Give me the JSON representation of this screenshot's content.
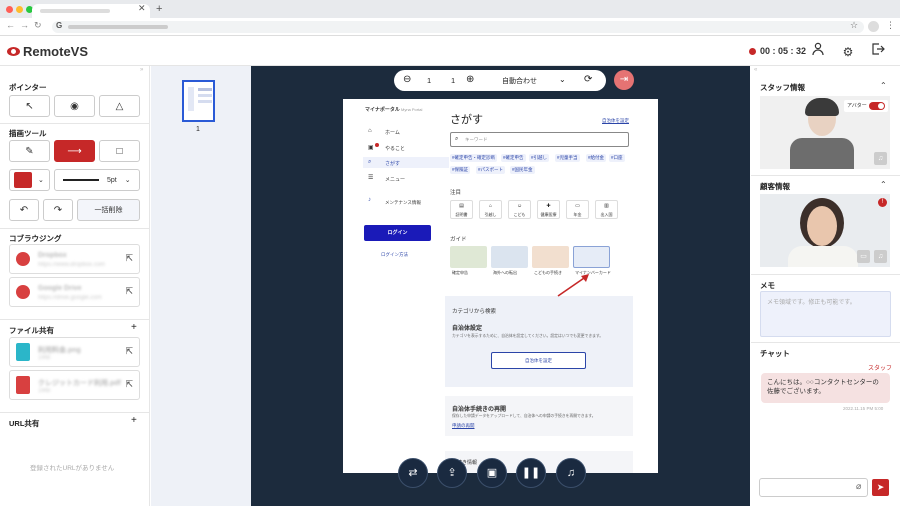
{
  "app": {
    "name": "RemoteVS",
    "timer": "00 : 05 : 32"
  },
  "left": {
    "pointer_title": "ポインター",
    "draw_title": "描画ツール",
    "stroke_size": "5pt",
    "clear_all": "一括削除",
    "cobrowse_title": "コブラウジング",
    "cobrowse": [
      {
        "name": "Dropbox",
        "url": "https://www.dropbox.com"
      },
      {
        "name": "Google Drive",
        "url": "https://drive.google.com"
      }
    ],
    "files_title": "ファイル共有",
    "files": [
      {
        "name": "利用料金.png",
        "size": "1MB",
        "type": "PNG"
      },
      {
        "name": "クレジットカード利用.pdf",
        "size": "1MB",
        "type": "PDF"
      }
    ],
    "url_title": "URL共有",
    "url_empty": "登録されたURLがありません"
  },
  "toolbar": {
    "page": "1",
    "total": "1",
    "zoom": "自動合わせ"
  },
  "thumb": {
    "page_num": "1"
  },
  "doc": {
    "portal": "マイナポータル",
    "portal_sub": "Myna Portal",
    "nav": [
      "ホーム",
      "やること",
      "さがす",
      "メニュー",
      "メンテナンス情報"
    ],
    "login": "ログイン",
    "login_how": "ログイン方法",
    "search_title": "さがす",
    "local_link": "自治体を設定",
    "search_ph": "キーワード",
    "chips_row1": [
      "#確定申告・確定診断",
      "#確定申告",
      "#引越し",
      "#児童手当",
      "#給付金",
      "#口座"
    ],
    "chips_row2": [
      "#保険証",
      "#パスポート",
      "#国民年金"
    ],
    "attention_title": "注目",
    "attention": [
      "証明書",
      "引越し",
      "こども",
      "健康医療",
      "年金",
      "出入国"
    ],
    "guide_title": "ガイド",
    "guides": [
      "確定申告",
      "海外への転出",
      "こどもの手続き",
      "マイナンバーカード"
    ],
    "cat_label": "カテゴリから検索",
    "local_title": "自治体設定",
    "local_desc": "カテゴリを表示するために、自治体を設定してください。設定はいつでも変更できます。",
    "local_btn": "自治体を設定",
    "resume_title": "自治体手続きの再開",
    "resume_desc": "保存した申請データをアップロードして、自治体への申請の手続きを再開できます。",
    "resume_link": "申請の再開",
    "extra": "手続き情報"
  },
  "right": {
    "staff_title": "スタッフ情報",
    "avatar_toggle": "アバター",
    "customer_title": "顧客情報",
    "memo_title": "メモ",
    "memo_ph": "メモ領域です。修正も可能です。",
    "chat_title": "チャット",
    "chat_sender": "スタッフ",
    "chat_msg": "こんにちは。○○コンタクトセンターの佐藤でございます。",
    "chat_time": "2022.11.15 PM 5:00"
  },
  "colors": {
    "brand": "#c62828",
    "primary": "#1a3ca8",
    "stage": "#1c2b3d"
  }
}
